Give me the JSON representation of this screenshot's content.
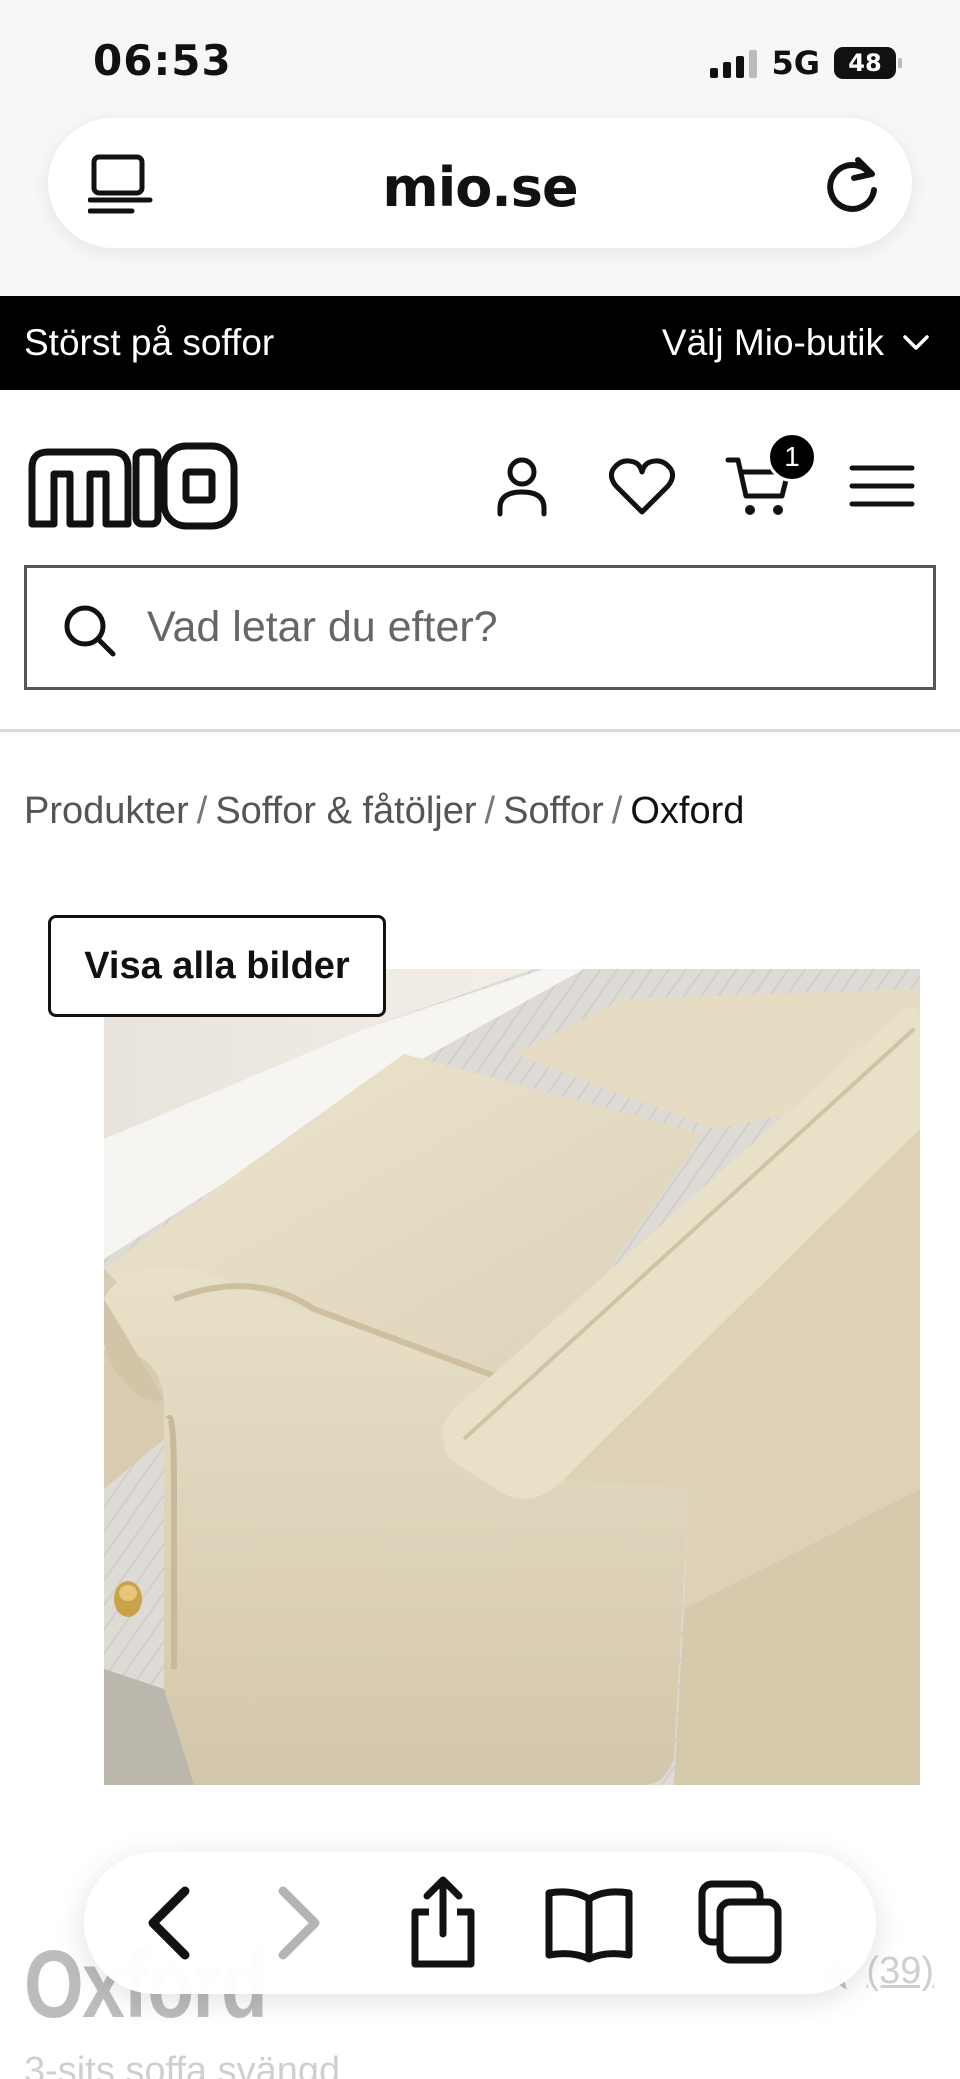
{
  "status_bar": {
    "time": "06:53",
    "network": "5G",
    "battery": "48"
  },
  "browser": {
    "url": "mio.se",
    "reader_icon": "reader-icon",
    "reload_icon": "reload-icon"
  },
  "promo": {
    "left_text": "Störst på soffor",
    "store_selector": "Välj Mio-butik"
  },
  "header": {
    "logo_alt": "mio",
    "icons": [
      "account-icon",
      "heart-icon",
      "cart-icon",
      "menu-icon"
    ],
    "cart_count": "1",
    "search_placeholder": "Vad letar du efter?"
  },
  "breadcrumb": {
    "items": [
      "Produkter",
      "Soffor & fåtöljer",
      "Soffor",
      "Oxford"
    ],
    "separator": "/"
  },
  "product": {
    "show_all_images": "Visa alla bilder",
    "title": "Oxford",
    "subtitle": "3-sits soffa svängd",
    "rating_count": "(39)"
  },
  "toolbar": {
    "icons": [
      "back-icon",
      "forward-icon",
      "share-icon",
      "bookmarks-icon",
      "tabs-icon"
    ]
  },
  "colors": {
    "banner_bg": "#000000",
    "text": "#111111",
    "sofa_fabric": "#e6dcc4",
    "floor": "#d9d6d1"
  }
}
